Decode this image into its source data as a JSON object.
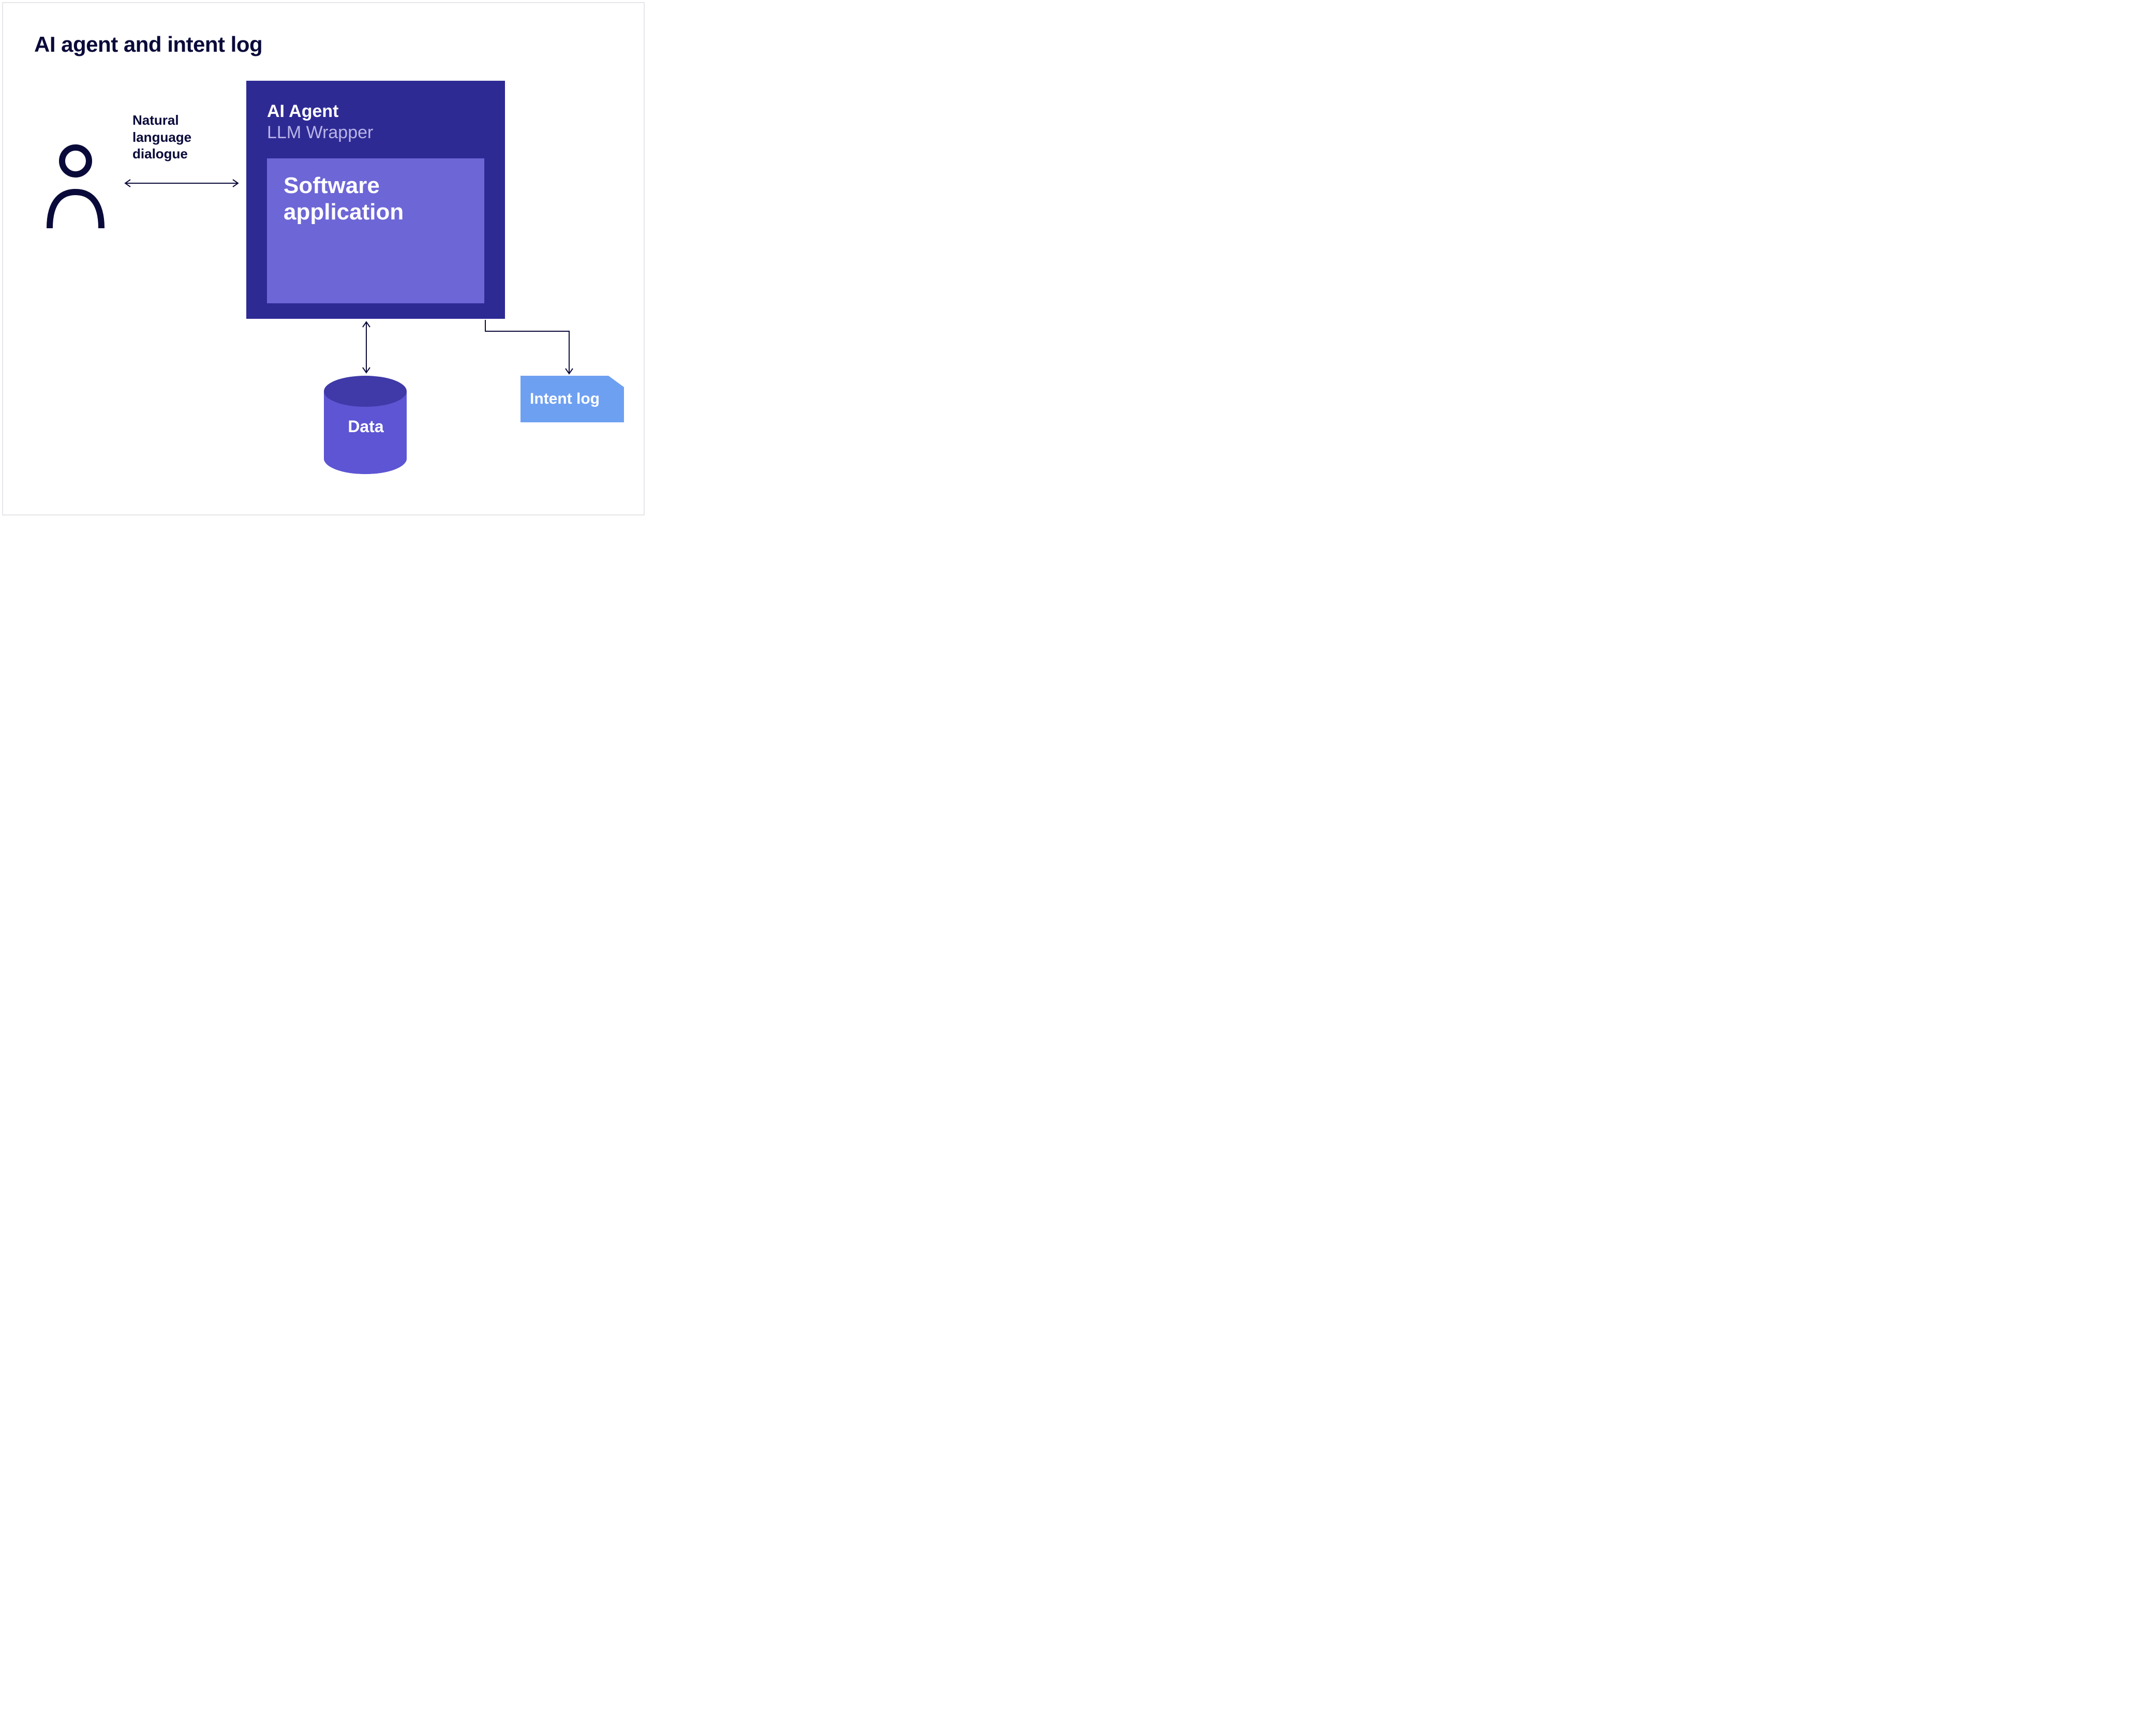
{
  "title": "AI agent and intent log",
  "dialogue_label": "Natural\nlanguage\ndialogue",
  "agent": {
    "title": "AI Agent",
    "subtitle": "LLM Wrapper",
    "software": "Software\napplication"
  },
  "data_label": "Data",
  "intent_label": "Intent log",
  "colors": {
    "ink": "#0a0a3a",
    "agent_bg": "#2e2a94",
    "software_bg": "#6d66d6",
    "data_cyl": "#5d55d4",
    "data_cyl_top": "#3f3aa8",
    "intent_bg": "#6ea0f2"
  }
}
